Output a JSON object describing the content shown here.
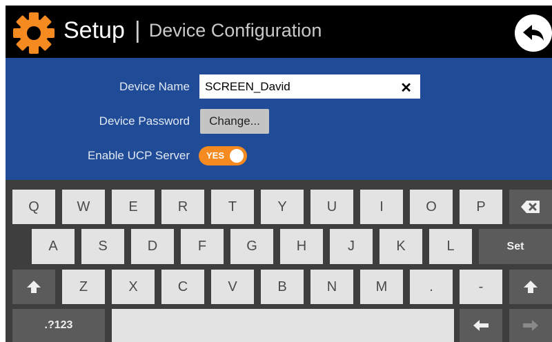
{
  "header": {
    "title": "Setup",
    "separator": "|",
    "subtitle": "Device Configuration",
    "icon": "gear-icon",
    "back_icon": "back-arrow-icon"
  },
  "form": {
    "device_name": {
      "label": "Device Name",
      "value": "SCREEN_David",
      "clear_glyph": "✕"
    },
    "device_password": {
      "label": "Device Password",
      "button": "Change..."
    },
    "ucp_server": {
      "label": "Enable UCP Server",
      "toggle_text": "YES",
      "enabled": true
    }
  },
  "keyboard": {
    "row1": [
      "Q",
      "W",
      "E",
      "R",
      "T",
      "Y",
      "U",
      "I",
      "O",
      "P"
    ],
    "row2": [
      "A",
      "S",
      "D",
      "F",
      "G",
      "H",
      "J",
      "K",
      "L"
    ],
    "row3": [
      "Z",
      "X",
      "C",
      "V",
      "B",
      "N",
      "M",
      ".",
      "-"
    ],
    "set_label": "Set",
    "numeric_label": ".?123",
    "backspace_icon": "backspace-icon",
    "shift_icon": "shift-icon",
    "left_arrow_icon": "left-arrow-icon",
    "right_arrow_icon": "right-arrow-icon"
  },
  "colors": {
    "accent": "#f58a20",
    "panel": "#1f4b97",
    "header": "#000000",
    "keyboard_bg": "#3e3e3e",
    "key_light": "#e3e3e3",
    "key_dark": "#5b5b5b"
  }
}
